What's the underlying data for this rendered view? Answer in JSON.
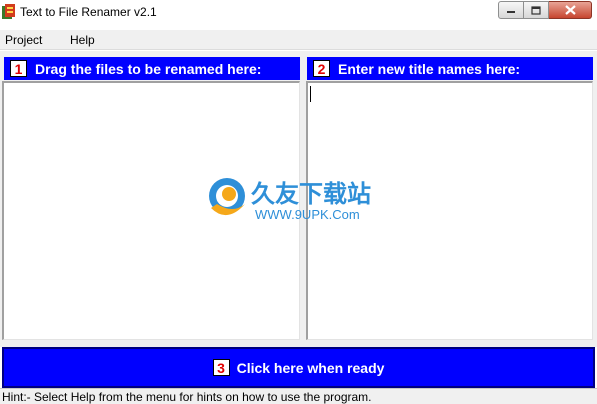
{
  "window": {
    "title": "Text to File Renamer v2.1",
    "controls": {
      "minimize": "minimize",
      "maximize": "maximize",
      "close": "close"
    }
  },
  "menu": {
    "items": [
      "Project",
      "Help"
    ]
  },
  "left_panel": {
    "number": "1",
    "header": "Drag the files to be renamed here:"
  },
  "right_panel": {
    "number": "2",
    "header": "Enter new title names here:",
    "value": ""
  },
  "ready_button": {
    "number": "3",
    "label": "Click here when ready"
  },
  "watermark": {
    "title": "久友下载站",
    "url": "WWW.9UPK.Com"
  },
  "status": {
    "hint": "Hint:- Select Help from the menu for hints on how to use the program."
  },
  "colors": {
    "header_bg": "#0000ff",
    "badge_number": "#e00000",
    "watermark": "#2e8fd8"
  }
}
